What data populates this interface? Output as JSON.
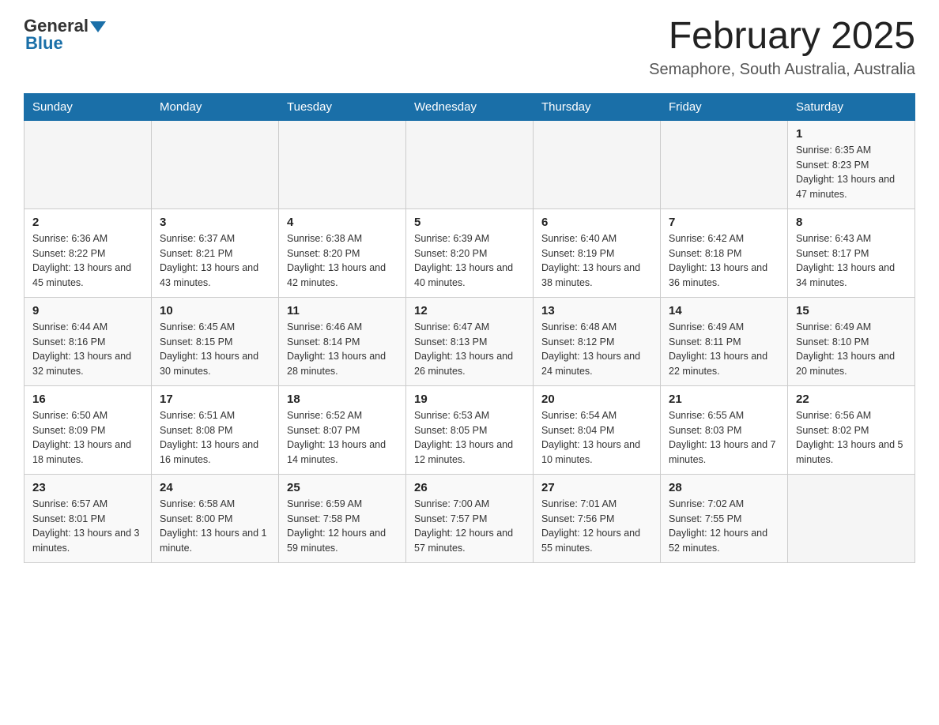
{
  "header": {
    "logo_general": "General",
    "logo_blue": "Blue",
    "month_title": "February 2025",
    "location": "Semaphore, South Australia, Australia"
  },
  "days_of_week": [
    "Sunday",
    "Monday",
    "Tuesday",
    "Wednesday",
    "Thursday",
    "Friday",
    "Saturday"
  ],
  "weeks": [
    {
      "days": [
        {
          "num": "",
          "info": ""
        },
        {
          "num": "",
          "info": ""
        },
        {
          "num": "",
          "info": ""
        },
        {
          "num": "",
          "info": ""
        },
        {
          "num": "",
          "info": ""
        },
        {
          "num": "",
          "info": ""
        },
        {
          "num": "1",
          "info": "Sunrise: 6:35 AM\nSunset: 8:23 PM\nDaylight: 13 hours and 47 minutes."
        }
      ]
    },
    {
      "days": [
        {
          "num": "2",
          "info": "Sunrise: 6:36 AM\nSunset: 8:22 PM\nDaylight: 13 hours and 45 minutes."
        },
        {
          "num": "3",
          "info": "Sunrise: 6:37 AM\nSunset: 8:21 PM\nDaylight: 13 hours and 43 minutes."
        },
        {
          "num": "4",
          "info": "Sunrise: 6:38 AM\nSunset: 8:20 PM\nDaylight: 13 hours and 42 minutes."
        },
        {
          "num": "5",
          "info": "Sunrise: 6:39 AM\nSunset: 8:20 PM\nDaylight: 13 hours and 40 minutes."
        },
        {
          "num": "6",
          "info": "Sunrise: 6:40 AM\nSunset: 8:19 PM\nDaylight: 13 hours and 38 minutes."
        },
        {
          "num": "7",
          "info": "Sunrise: 6:42 AM\nSunset: 8:18 PM\nDaylight: 13 hours and 36 minutes."
        },
        {
          "num": "8",
          "info": "Sunrise: 6:43 AM\nSunset: 8:17 PM\nDaylight: 13 hours and 34 minutes."
        }
      ]
    },
    {
      "days": [
        {
          "num": "9",
          "info": "Sunrise: 6:44 AM\nSunset: 8:16 PM\nDaylight: 13 hours and 32 minutes."
        },
        {
          "num": "10",
          "info": "Sunrise: 6:45 AM\nSunset: 8:15 PM\nDaylight: 13 hours and 30 minutes."
        },
        {
          "num": "11",
          "info": "Sunrise: 6:46 AM\nSunset: 8:14 PM\nDaylight: 13 hours and 28 minutes."
        },
        {
          "num": "12",
          "info": "Sunrise: 6:47 AM\nSunset: 8:13 PM\nDaylight: 13 hours and 26 minutes."
        },
        {
          "num": "13",
          "info": "Sunrise: 6:48 AM\nSunset: 8:12 PM\nDaylight: 13 hours and 24 minutes."
        },
        {
          "num": "14",
          "info": "Sunrise: 6:49 AM\nSunset: 8:11 PM\nDaylight: 13 hours and 22 minutes."
        },
        {
          "num": "15",
          "info": "Sunrise: 6:49 AM\nSunset: 8:10 PM\nDaylight: 13 hours and 20 minutes."
        }
      ]
    },
    {
      "days": [
        {
          "num": "16",
          "info": "Sunrise: 6:50 AM\nSunset: 8:09 PM\nDaylight: 13 hours and 18 minutes."
        },
        {
          "num": "17",
          "info": "Sunrise: 6:51 AM\nSunset: 8:08 PM\nDaylight: 13 hours and 16 minutes."
        },
        {
          "num": "18",
          "info": "Sunrise: 6:52 AM\nSunset: 8:07 PM\nDaylight: 13 hours and 14 minutes."
        },
        {
          "num": "19",
          "info": "Sunrise: 6:53 AM\nSunset: 8:05 PM\nDaylight: 13 hours and 12 minutes."
        },
        {
          "num": "20",
          "info": "Sunrise: 6:54 AM\nSunset: 8:04 PM\nDaylight: 13 hours and 10 minutes."
        },
        {
          "num": "21",
          "info": "Sunrise: 6:55 AM\nSunset: 8:03 PM\nDaylight: 13 hours and 7 minutes."
        },
        {
          "num": "22",
          "info": "Sunrise: 6:56 AM\nSunset: 8:02 PM\nDaylight: 13 hours and 5 minutes."
        }
      ]
    },
    {
      "days": [
        {
          "num": "23",
          "info": "Sunrise: 6:57 AM\nSunset: 8:01 PM\nDaylight: 13 hours and 3 minutes."
        },
        {
          "num": "24",
          "info": "Sunrise: 6:58 AM\nSunset: 8:00 PM\nDaylight: 13 hours and 1 minute."
        },
        {
          "num": "25",
          "info": "Sunrise: 6:59 AM\nSunset: 7:58 PM\nDaylight: 12 hours and 59 minutes."
        },
        {
          "num": "26",
          "info": "Sunrise: 7:00 AM\nSunset: 7:57 PM\nDaylight: 12 hours and 57 minutes."
        },
        {
          "num": "27",
          "info": "Sunrise: 7:01 AM\nSunset: 7:56 PM\nDaylight: 12 hours and 55 minutes."
        },
        {
          "num": "28",
          "info": "Sunrise: 7:02 AM\nSunset: 7:55 PM\nDaylight: 12 hours and 52 minutes."
        },
        {
          "num": "",
          "info": ""
        }
      ]
    }
  ]
}
